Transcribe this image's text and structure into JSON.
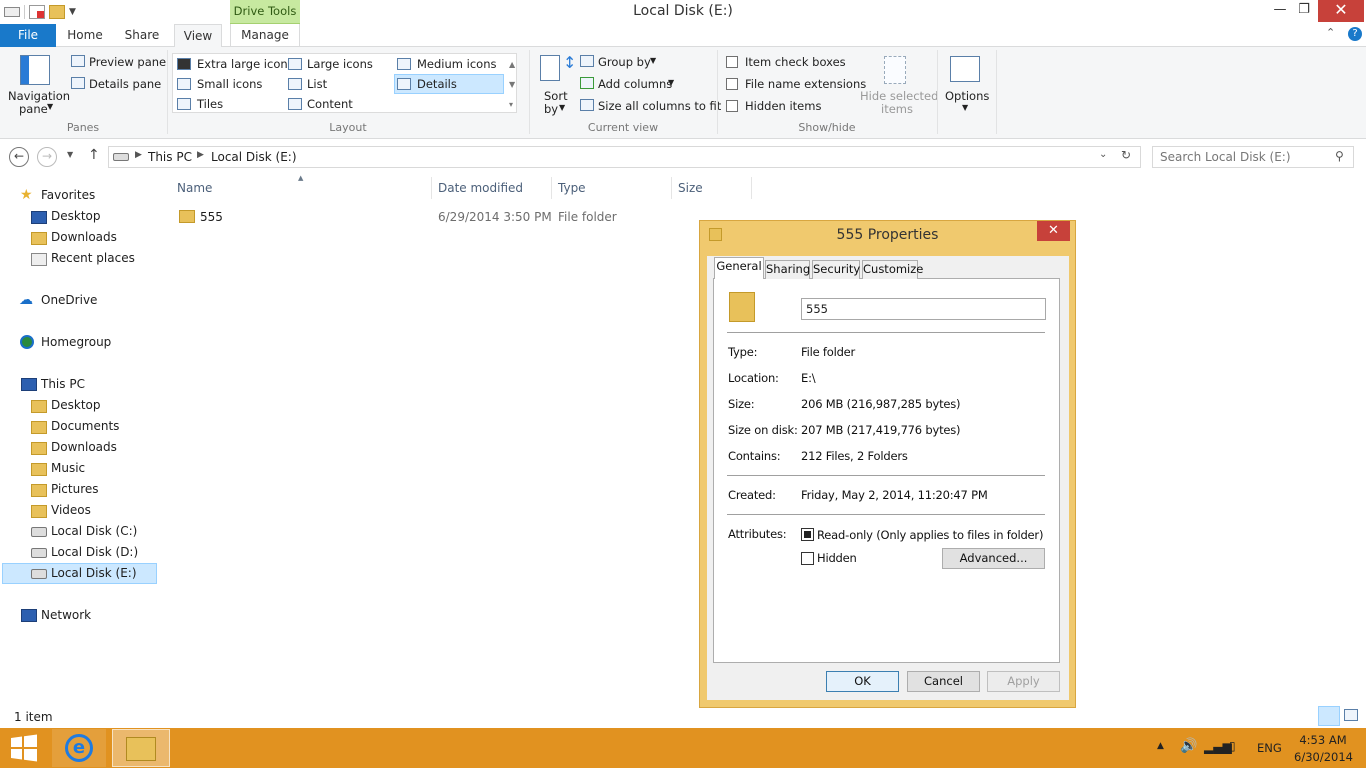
{
  "window": {
    "title": "Local Disk (E:)",
    "context_tab": "Drive Tools"
  },
  "tabs": [
    "File",
    "Home",
    "Share",
    "View",
    "Manage"
  ],
  "ribbon": {
    "panes": {
      "nav_pane_1": "Navigation",
      "nav_pane_2": "pane",
      "preview": "Preview pane",
      "details": "Details pane",
      "label": "Panes"
    },
    "layout": {
      "items": [
        "Extra large icons",
        "Large icons",
        "Medium icons",
        "Small icons",
        "List",
        "Details",
        "Tiles",
        "Content"
      ],
      "label": "Layout"
    },
    "current_view": {
      "sort_1": "Sort",
      "sort_2": "by",
      "group": "Group by",
      "add_columns": "Add columns",
      "size_all": "Size all columns to fit",
      "label": "Current view"
    },
    "show_hide": {
      "item_check": "Item check boxes",
      "file_ext": "File name extensions",
      "hidden": "Hidden items",
      "hide_sel_1": "Hide selected",
      "hide_sel_2": "items",
      "label": "Show/hide"
    },
    "options": "Options"
  },
  "address": {
    "crumbs": [
      "This PC",
      "Local Disk (E:)"
    ],
    "search_placeholder": "Search Local Disk (E:)"
  },
  "nav": {
    "favorites": "Favorites",
    "fav_items": [
      "Desktop",
      "Downloads",
      "Recent places"
    ],
    "onedrive": "OneDrive",
    "homegroup": "Homegroup",
    "thispc": "This PC",
    "pc_items": [
      "Desktop",
      "Documents",
      "Downloads",
      "Music",
      "Pictures",
      "Videos",
      "Local Disk (C:)",
      "Local Disk (D:)",
      "Local Disk (E:)"
    ],
    "network": "Network"
  },
  "columns": [
    "Name",
    "Date modified",
    "Type",
    "Size"
  ],
  "files": [
    {
      "name": "555",
      "date": "6/29/2014 3:50 PM",
      "type": "File folder",
      "size": ""
    }
  ],
  "status": "1 item",
  "dialog": {
    "title": "555 Properties",
    "tabs": [
      "General",
      "Sharing",
      "Security",
      "Customize"
    ],
    "name_value": "555",
    "type_label": "Type:",
    "type": "File folder",
    "location_label": "Location:",
    "location": "E:\\",
    "size_label": "Size:",
    "size": "206 MB (216,987,285 bytes)",
    "sod_label": "Size on disk:",
    "size_on_disk": "207 MB (217,419,776 bytes)",
    "contains_label": "Contains:",
    "contains": "212 Files, 2 Folders",
    "created_label": "Created:",
    "created": "Friday, May 2, 2014, 11:20:47 PM",
    "attr_label": "Attributes:",
    "readonly": "Read-only (Only applies to files in folder)",
    "hidden": "Hidden",
    "advanced": "Advanced...",
    "ok": "OK",
    "cancel": "Cancel",
    "apply": "Apply"
  },
  "tray": {
    "lang": "ENG",
    "time": "4:53 AM",
    "date": "6/30/2014"
  },
  "colors": {
    "file_tab": "#1979ca",
    "taskbar": "#e19220",
    "dialog_frame": "#f0c96e",
    "close": "#c7413a",
    "selection": "#cce8ff"
  }
}
